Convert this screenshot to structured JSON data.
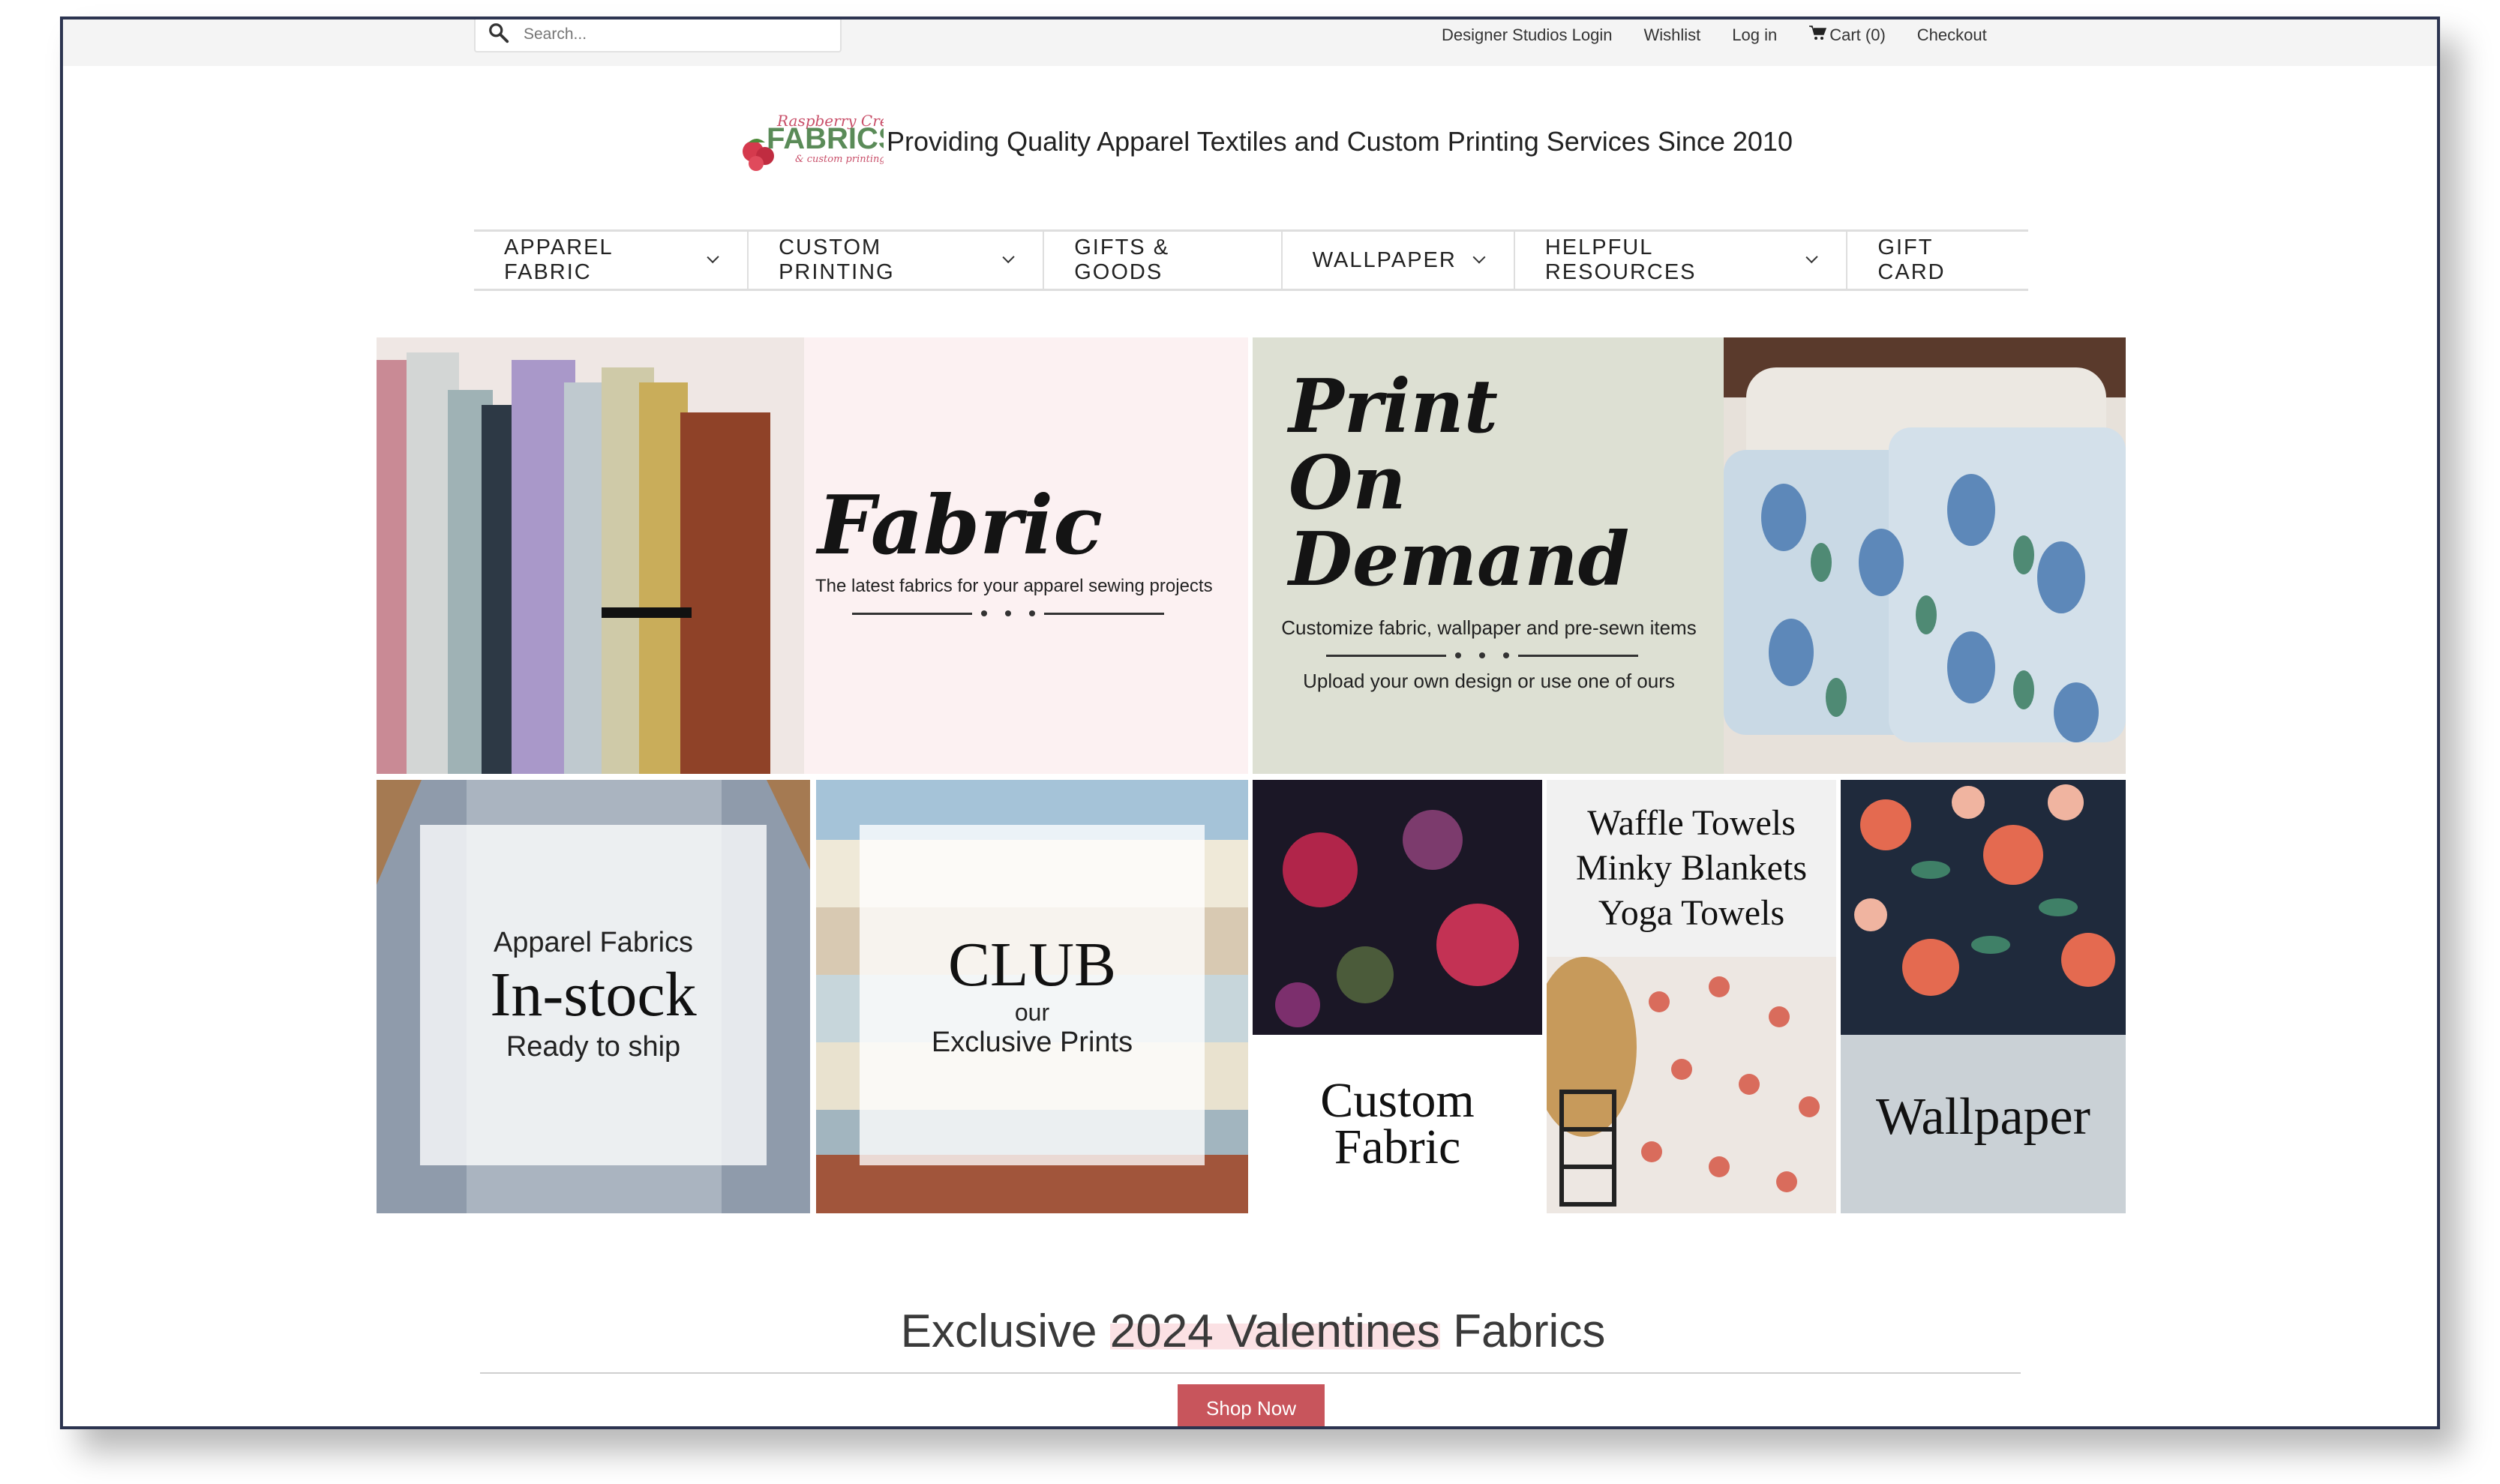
{
  "topbar": {
    "search_placeholder": "Search...",
    "links": [
      "Designer Studios Login",
      "Wishlist",
      "Log in",
      "Cart (0)",
      "Checkout"
    ]
  },
  "header": {
    "logo_text_top": "Raspberry Creek",
    "logo_text_main": "FABRICS",
    "logo_text_bottom": "& custom printing",
    "tagline": "Providing Quality Apparel Textiles and Custom Printing Services Since 2010"
  },
  "nav": {
    "items": [
      {
        "label": "APPAREL FABRIC",
        "has_dropdown": true
      },
      {
        "label": "CUSTOM PRINTING",
        "has_dropdown": true
      },
      {
        "label": "GIFTS & GOODS",
        "has_dropdown": false
      },
      {
        "label": "WALLPAPER",
        "has_dropdown": true
      },
      {
        "label": "HELPFUL RESOURCES",
        "has_dropdown": true
      },
      {
        "label": "GIFT CARD",
        "has_dropdown": false
      }
    ]
  },
  "banners": {
    "fabric": {
      "title": "Fabric",
      "subtitle": "The latest fabrics for your apparel sewing projects"
    },
    "print_on_demand": {
      "title_line1": "Print",
      "title_line2": "On",
      "title_line3": "Demand",
      "sub1": "Customize fabric, wallpaper and pre-sewn items",
      "sub2": "Upload your own design or use one of ours"
    }
  },
  "tiles": {
    "instock": {
      "line1": "Apparel Fabrics",
      "line2": "In-stock",
      "line3": "Ready to ship"
    },
    "club": {
      "line1": "CLUB",
      "line2": "our",
      "line3": "Exclusive Prints"
    },
    "custom": {
      "line1": "Custom",
      "line2": "Fabric"
    },
    "towels": {
      "line1": "Waffle Towels",
      "line2": "Minky Blankets",
      "line3": "Yoga Towels"
    },
    "wallpaper": {
      "line1": "Wallpaper"
    }
  },
  "featured": {
    "title_pre": "Exclusive ",
    "title_hl": "2024 Valentines",
    "title_post": " Fabrics",
    "button": "Shop Now"
  },
  "colors": {
    "frame_border": "#2c3450",
    "fabric_banner_bg": "#fcf1f2",
    "pod_banner_bg": "#dde0d3",
    "shop_button": "#c8555c",
    "highlight": "#fbe1e4"
  }
}
